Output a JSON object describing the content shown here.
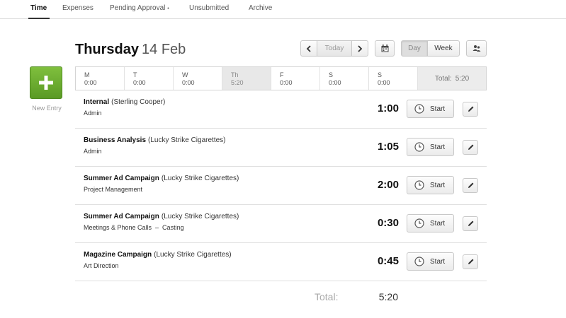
{
  "nav": {
    "tabs": [
      {
        "label": "Time",
        "active": true
      },
      {
        "label": "Expenses",
        "active": false
      },
      {
        "label": "Pending Approval",
        "active": false
      },
      {
        "label": "Unsubmitted",
        "active": false
      },
      {
        "label": "Archive",
        "active": false
      }
    ],
    "pending_dot": "•"
  },
  "header": {
    "day_of_week": "Thursday",
    "date": "14 Feb"
  },
  "toolbar": {
    "today_label": "Today",
    "day_label": "Day",
    "week_label": "Week",
    "prev_icon": "chevron-left-icon",
    "next_icon": "chevron-right-icon",
    "calendar_icon": "calendar-icon",
    "people_icon": "teammates-icon"
  },
  "new_entry": {
    "label": "New Entry",
    "icon": "plus-icon",
    "color": "#6aa82e"
  },
  "week": {
    "days": [
      {
        "letter": "M",
        "hours": "0:00"
      },
      {
        "letter": "T",
        "hours": "0:00"
      },
      {
        "letter": "W",
        "hours": "0:00"
      },
      {
        "letter": "Th",
        "hours": "5:20",
        "selected": true
      },
      {
        "letter": "F",
        "hours": "0:00"
      },
      {
        "letter": "S",
        "hours": "0:00"
      },
      {
        "letter": "S",
        "hours": "0:00"
      }
    ],
    "total_label": "Total:",
    "total_value": "5:20"
  },
  "entries": [
    {
      "project": "Internal",
      "client": "(Sterling Cooper)",
      "task": "Admin",
      "hours": "1:00",
      "start_label": "Start"
    },
    {
      "project": "Business Analysis",
      "client": "(Lucky Strike Cigarettes)",
      "task": "Admin",
      "hours": "1:05",
      "start_label": "Start"
    },
    {
      "project": "Summer Ad Campaign",
      "client": "(Lucky Strike Cigarettes)",
      "task": "Project Management",
      "hours": "2:00",
      "start_label": "Start"
    },
    {
      "project": "Summer Ad Campaign",
      "client": "(Lucky Strike Cigarettes)",
      "task": "Meetings & Phone Calls  –  Casting",
      "hours": "0:30",
      "start_label": "Start"
    },
    {
      "project": "Magazine Campaign",
      "client": "(Lucky Strike Cigarettes)",
      "task": "Art Direction",
      "hours": "0:45",
      "start_label": "Start"
    }
  ],
  "footer": {
    "total_label": "Total:",
    "total_value": "5:20"
  }
}
